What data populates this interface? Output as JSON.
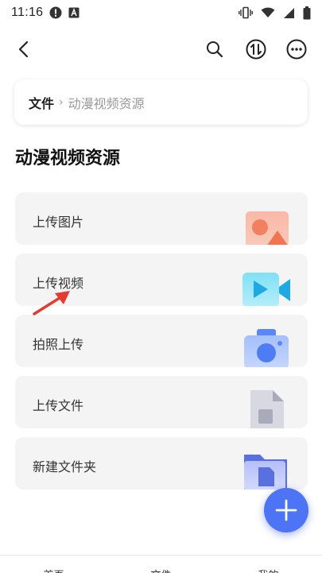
{
  "status_bar": {
    "time": "11:16",
    "icons": [
      "alert-circle-icon",
      "a-square-icon",
      "vibrate-icon",
      "wifi-icon",
      "signal-icon",
      "battery-icon"
    ]
  },
  "top_bar": {
    "icons": [
      "back-arrow-icon",
      "search-icon",
      "sort-icon",
      "more-icon"
    ]
  },
  "breadcrumb": {
    "root": "文件",
    "separator": "›",
    "current": "动漫视频资源"
  },
  "page_title": "动漫视频资源",
  "actions": [
    {
      "label": "上传图片",
      "icon": "image-icon"
    },
    {
      "label": "上传视频",
      "icon": "video-camera-icon"
    },
    {
      "label": "拍照上传",
      "icon": "camera-icon"
    },
    {
      "label": "上传文件",
      "icon": "file-icon"
    },
    {
      "label": "新建文件夹",
      "icon": "folder-icon"
    }
  ],
  "fab": {
    "icon": "plus-icon"
  },
  "bottom_nav": {
    "items": [
      "首页",
      "文件",
      "我的"
    ]
  },
  "colors": {
    "accent": "#4c74f4",
    "arrow_annotation": "#e53a2f",
    "card_bg": "#f4f4f5"
  }
}
